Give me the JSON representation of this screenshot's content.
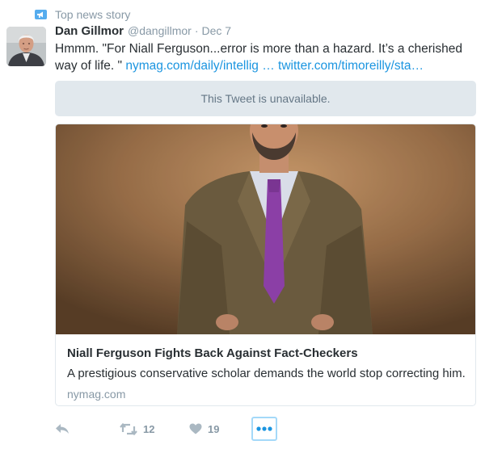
{
  "context": {
    "label": "Top news story",
    "icon": "megaphone-icon"
  },
  "tweet": {
    "author_name": "Dan Gillmor",
    "author_handle": "@dangillmor",
    "separator": "·",
    "date": "Dec 7",
    "text": "Hmmm. \"For Niall Ferguson...error is more than a hazard. It’s a cherished way of life. \" ",
    "link1": "nymag.com/daily/intellig …",
    "link2": "twitter.com/timoreilly/sta…"
  },
  "quoted": {
    "unavailable_text": "This Tweet is unavailable."
  },
  "card": {
    "title": "Niall Ferguson Fights Back Against Fact-Checkers",
    "description": "A prestigious conservative scholar demands the world stop correcting him.",
    "domain": "nymag.com"
  },
  "actions": {
    "retweet_count": "12",
    "like_count": "19"
  },
  "colors": {
    "link": "#1b95e0",
    "muted": "#8899a6",
    "text": "#292f33",
    "unavailable_bg": "#e1e8ed",
    "focus_ring": "#a4d9f9"
  }
}
